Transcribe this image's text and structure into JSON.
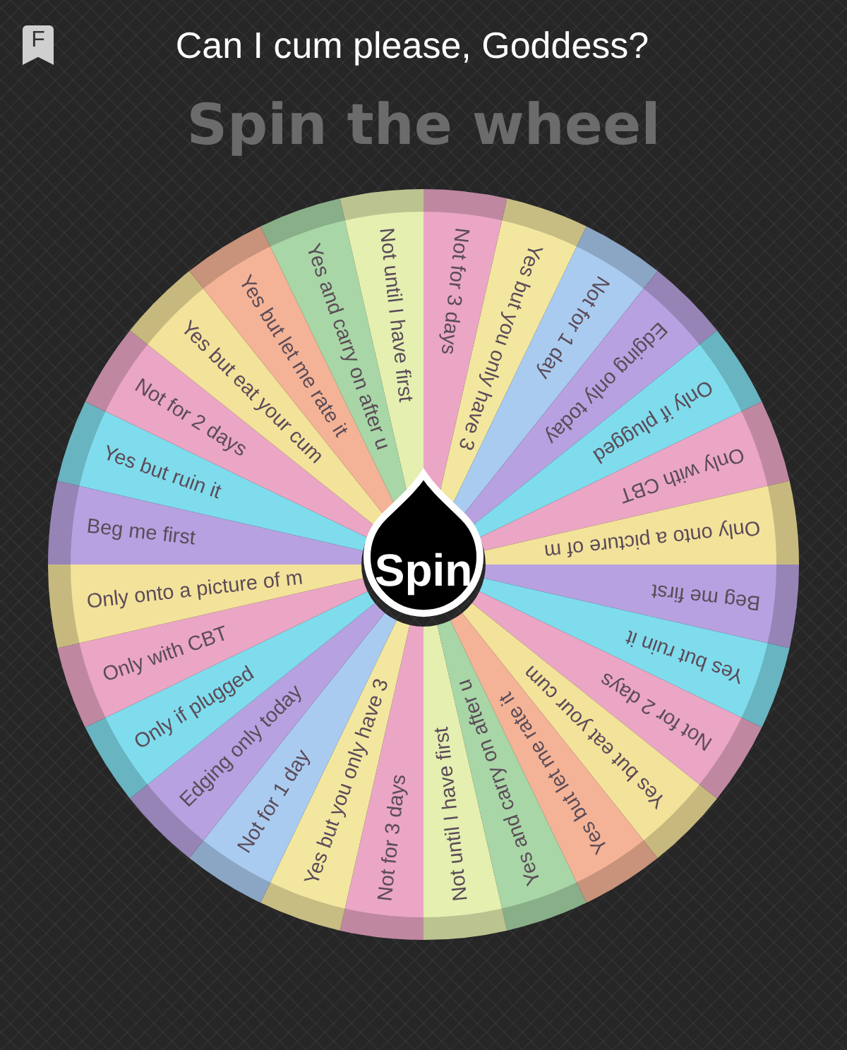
{
  "header": {
    "badge_letter": "F",
    "title": "Can I cum please, Goddess?"
  },
  "heading": "Spin the wheel",
  "wheel": {
    "button": "Spin",
    "segments": [
      {
        "label": "Not for 3 days",
        "color": "#eaa6c4"
      },
      {
        "label": "Yes but you only have 3",
        "color": "#f3e7a0"
      },
      {
        "label": "Not for 1 day",
        "color": "#aacbf0"
      },
      {
        "label": "Edging only today",
        "color": "#b7a1e0"
      },
      {
        "label": "Only if plugged",
        "color": "#7fdcec"
      },
      {
        "label": "Only with CBT",
        "color": "#eaa6c4"
      },
      {
        "label": "Only onto a picture of m",
        "color": "#f3e29a"
      },
      {
        "label": "Beg me first",
        "color": "#b7a1e0"
      },
      {
        "label": "Yes but ruin it",
        "color": "#7fdcec"
      },
      {
        "label": "Not for 2 days",
        "color": "#eaa6c4"
      },
      {
        "label": "Yes but eat your cum",
        "color": "#f3e29a"
      },
      {
        "label": "Yes but let me rate it",
        "color": "#f4b396"
      },
      {
        "label": "Yes and carry on after u",
        "color": "#a8d6a6"
      },
      {
        "label": "Not until I have first",
        "color": "#e4efb0"
      },
      {
        "label": "Not for 3 days",
        "color": "#eaa6c4"
      },
      {
        "label": "Yes but you only have 3",
        "color": "#f3e7a0"
      },
      {
        "label": "Not for 1 day",
        "color": "#aacbf0"
      },
      {
        "label": "Edging only today",
        "color": "#b7a1e0"
      },
      {
        "label": "Only if plugged",
        "color": "#7fdcec"
      },
      {
        "label": "Only with CBT",
        "color": "#eaa6c4"
      },
      {
        "label": "Only onto a picture of m",
        "color": "#f3e29a"
      },
      {
        "label": "Beg me first",
        "color": "#b7a1e0"
      },
      {
        "label": "Yes but ruin it",
        "color": "#7fdcec"
      },
      {
        "label": "Not for 2 days",
        "color": "#eaa6c4"
      },
      {
        "label": "Yes but eat your cum",
        "color": "#f3e29a"
      },
      {
        "label": "Yes but let me rate it",
        "color": "#f4b396"
      },
      {
        "label": "Yes and carry on after u",
        "color": "#a8d6a6"
      },
      {
        "label": "Not until I have first",
        "color": "#e4efb0"
      }
    ]
  }
}
